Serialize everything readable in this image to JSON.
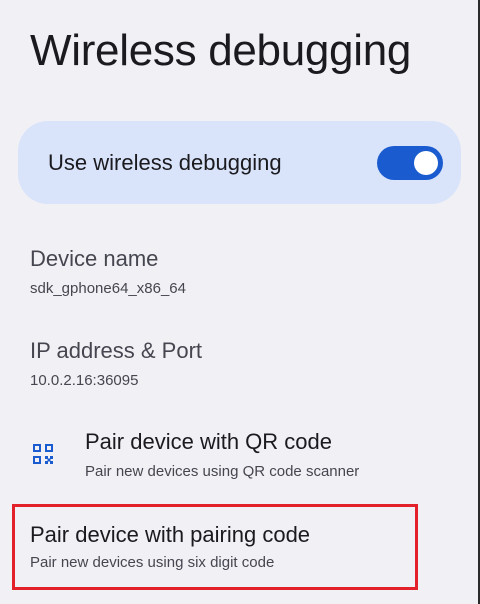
{
  "header": {
    "title": "Wireless debugging"
  },
  "toggle": {
    "label": "Use wireless debugging",
    "enabled": true,
    "accent_color": "#1a5ccf",
    "card_color": "#d9e4fa"
  },
  "device": {
    "label": "Device name",
    "value": "sdk_gphone64_x86_64"
  },
  "ip": {
    "label": "IP address & Port",
    "value": "10.0.2.16:36095"
  },
  "pair_qr": {
    "title": "Pair device with QR code",
    "subtitle": "Pair new devices using QR code scanner",
    "icon": "qr-code-scanner-icon"
  },
  "pair_code": {
    "title": "Pair device with pairing code",
    "subtitle": "Pair new devices using six digit code",
    "highlight_color": "#e3212a"
  }
}
